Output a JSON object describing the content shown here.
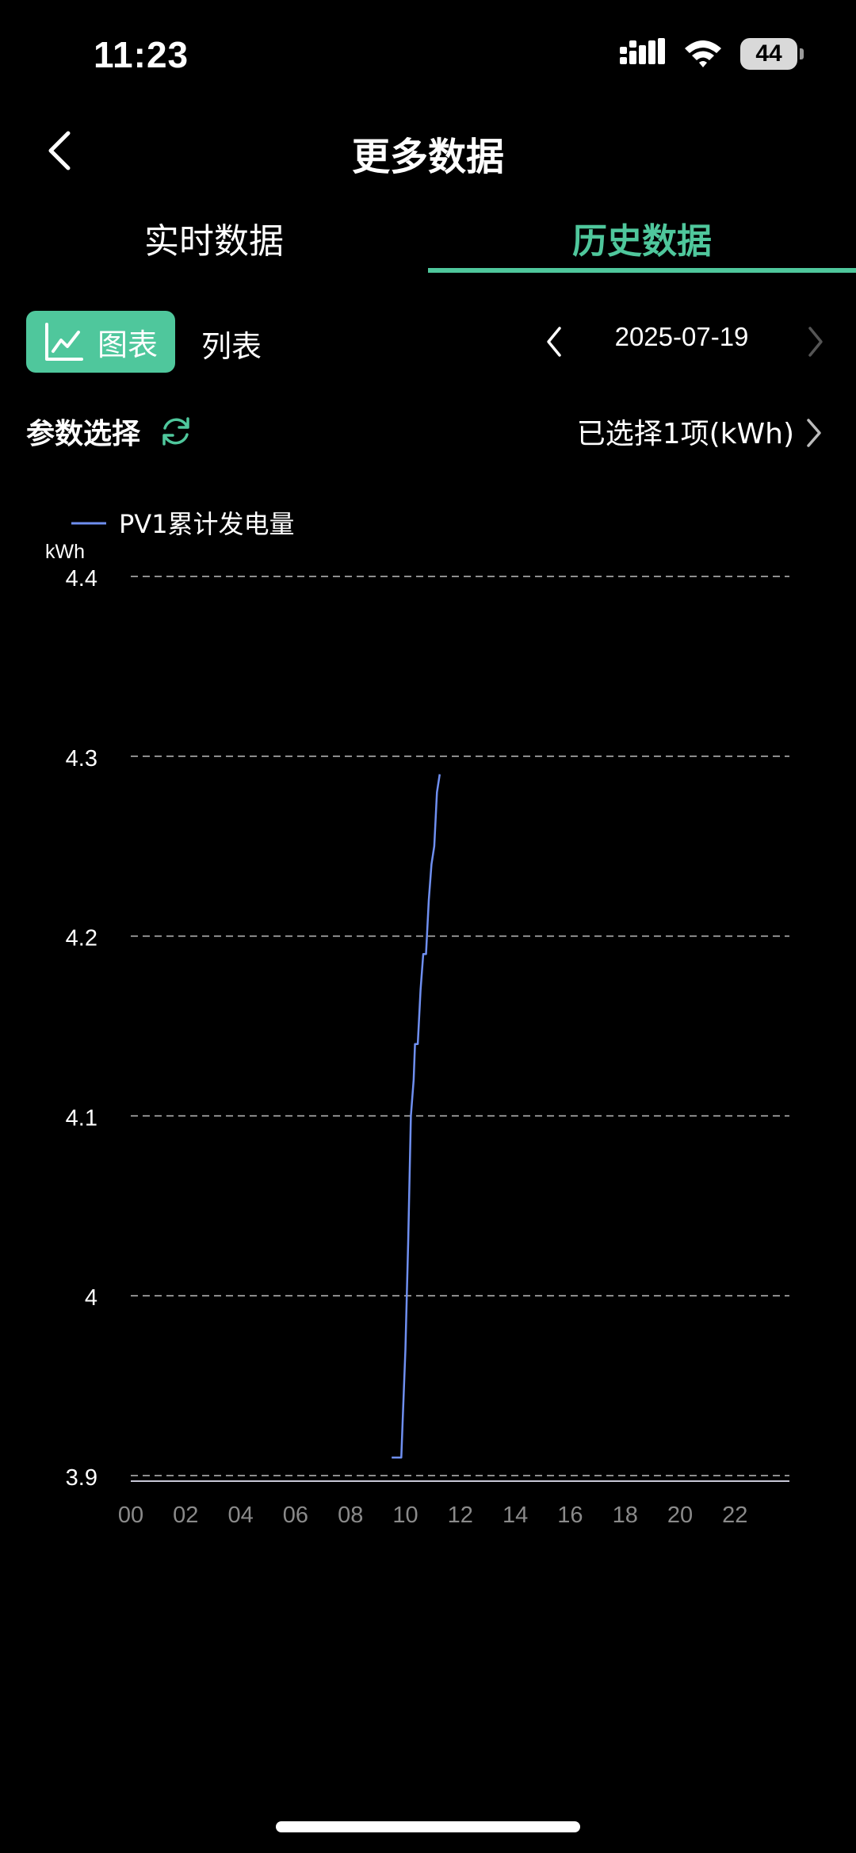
{
  "status_bar": {
    "time": "11:23",
    "battery": "44"
  },
  "header": {
    "title": "更多数据"
  },
  "tabs": [
    {
      "label": "实时数据",
      "active": false
    },
    {
      "label": "历史数据",
      "active": true
    }
  ],
  "toolbar": {
    "chart_label": "图表",
    "list_label": "列表",
    "date": "2025-07-19"
  },
  "params": {
    "label": "参数选择",
    "selected": "已选择1项(kWh)"
  },
  "colors": {
    "accent": "#4fc79c",
    "series": "#6f8ff0",
    "background": "#000000"
  },
  "chart_data": {
    "type": "line",
    "ylabel": "kWh",
    "ylim": [
      3.9,
      4.4
    ],
    "yticks": [
      {
        "value": 4.4,
        "label": "4.4"
      },
      {
        "value": 4.3,
        "label": "4.3"
      },
      {
        "value": 4.2,
        "label": "4.2"
      },
      {
        "value": 4.1,
        "label": "4.1"
      },
      {
        "value": 4.0,
        "label": "4"
      },
      {
        "value": 3.9,
        "label": "3.9"
      }
    ],
    "xlim": [
      0,
      24
    ],
    "xticks": [
      {
        "value": 0,
        "label": "00"
      },
      {
        "value": 2,
        "label": "02"
      },
      {
        "value": 4,
        "label": "04"
      },
      {
        "value": 6,
        "label": "06"
      },
      {
        "value": 8,
        "label": "08"
      },
      {
        "value": 10,
        "label": "10"
      },
      {
        "value": 12,
        "label": "12"
      },
      {
        "value": 14,
        "label": "14"
      },
      {
        "value": 16,
        "label": "16"
      },
      {
        "value": 18,
        "label": "18"
      },
      {
        "value": 20,
        "label": "20"
      },
      {
        "value": 22,
        "label": "22"
      }
    ],
    "grid": true,
    "legend_position": "top-left",
    "series": [
      {
        "name": "PV1累计发电量",
        "color": "#6f8ff0",
        "points": [
          [
            9.5,
            3.91
          ],
          [
            9.85,
            3.91
          ],
          [
            9.9,
            3.93
          ],
          [
            10.0,
            3.97
          ],
          [
            10.1,
            4.03
          ],
          [
            10.2,
            4.1
          ],
          [
            10.3,
            4.12
          ],
          [
            10.35,
            4.14
          ],
          [
            10.45,
            4.14
          ],
          [
            10.55,
            4.17
          ],
          [
            10.65,
            4.19
          ],
          [
            10.75,
            4.19
          ],
          [
            10.85,
            4.22
          ],
          [
            10.95,
            4.24
          ],
          [
            11.05,
            4.25
          ],
          [
            11.15,
            4.28
          ],
          [
            11.25,
            4.29
          ]
        ]
      }
    ]
  }
}
